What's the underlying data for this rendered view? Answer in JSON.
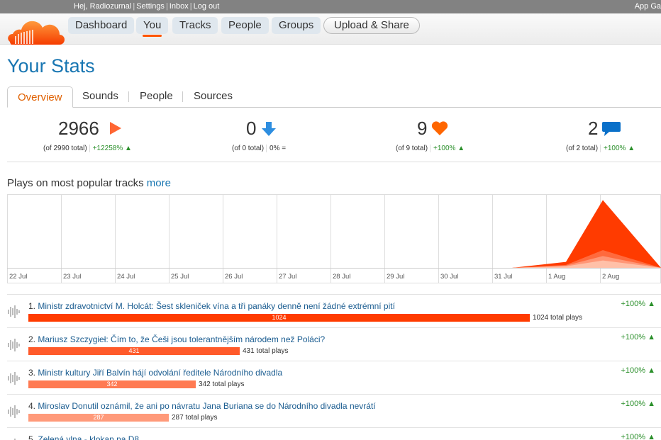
{
  "topbar": {
    "greeting": "Hej,",
    "username": "Radiozurnal",
    "links": [
      "Settings",
      "Inbox",
      "Log out"
    ],
    "app_gallery": "App Ga"
  },
  "nav": {
    "items": [
      "Dashboard",
      "You",
      "Tracks",
      "People",
      "Groups"
    ],
    "active": "You",
    "upload": "Upload & Share"
  },
  "page_title": "Your Stats",
  "tabs": [
    "Overview",
    "Sounds",
    "People",
    "Sources"
  ],
  "stats": [
    {
      "value": "2966",
      "total": "(of 2990 total)",
      "change": "+12258%",
      "trend": "up",
      "icon": "play-icon",
      "color": "#f63"
    },
    {
      "value": "0",
      "total": "(of 0 total)",
      "change": "0%",
      "trend": "equal",
      "icon": "download-icon",
      "color": "#2e8ee0"
    },
    {
      "value": "9",
      "total": "(of 9 total)",
      "change": "+100%",
      "trend": "up",
      "icon": "heart-icon",
      "color": "#f60"
    },
    {
      "value": "2",
      "total": "(of 2 total)",
      "change": "+100%",
      "trend": "up",
      "icon": "comment-icon",
      "color": "#0a70c9"
    }
  ],
  "section": {
    "title": "Plays on most popular tracks",
    "more": "more"
  },
  "chart_data": {
    "type": "area",
    "x": [
      "22 Jul",
      "23 Jul",
      "24 Jul",
      "25 Jul",
      "26 Jul",
      "27 Jul",
      "28 Jul",
      "29 Jul",
      "30 Jul",
      "31 Jul",
      "1 Aug",
      "2 Aug"
    ],
    "series": [
      {
        "values": [
          0,
          0,
          0,
          0,
          0,
          0,
          0,
          0,
          0,
          0,
          0.08,
          0.92
        ]
      },
      {
        "values": [
          0,
          0,
          0,
          0,
          0,
          0,
          0,
          0,
          0,
          0,
          0.04,
          0.24
        ]
      },
      {
        "values": [
          0,
          0,
          0,
          0,
          0,
          0,
          0,
          0,
          0,
          0,
          0.03,
          0.16
        ]
      },
      {
        "values": [
          0,
          0,
          0,
          0,
          0,
          0,
          0,
          0,
          0,
          0,
          0.02,
          0.1
        ]
      }
    ],
    "colors": [
      "#ff3b00",
      "#ff6a3d",
      "#ff9676",
      "#ffc0a8"
    ],
    "grid": true
  },
  "tracks": [
    {
      "rank": "1.",
      "title": "Ministr zdravotnictví M. Holcát: Šest skleniček vína a tři panáky denně není žádné extrémní pití",
      "plays": 1024,
      "plays_label": "1024",
      "total_label": "1024 total plays",
      "change": "+100%",
      "color": "#ff3b00"
    },
    {
      "rank": "2.",
      "title": "Mariusz Szczygieł: Čím to, že Češi jsou tolerantnějším národem než Poláci?",
      "plays": 431,
      "plays_label": "431",
      "total_label": "431 total plays",
      "change": "+100%",
      "color": "#ff5a2a"
    },
    {
      "rank": "3.",
      "title": "Ministr kultury Jiří Balvín hájí odvolání ředitele Národního divadla",
      "plays": 342,
      "plays_label": "342",
      "total_label": "342 total plays",
      "change": "+100%",
      "color": "#ff7a52"
    },
    {
      "rank": "4.",
      "title": "Miroslav Donutil oznámil, že ani po návratu Jana Buriana se do Národního divadla nevrátí",
      "plays": 287,
      "plays_label": "287",
      "total_label": "287 total plays",
      "change": "+100%",
      "color": "#ff9a7a"
    },
    {
      "rank": "5.",
      "title": "Zelená vlna - klokan na D8",
      "plays": 0,
      "plays_label": "",
      "total_label": "",
      "change": "+100%",
      "color": "#ffb59c"
    }
  ]
}
